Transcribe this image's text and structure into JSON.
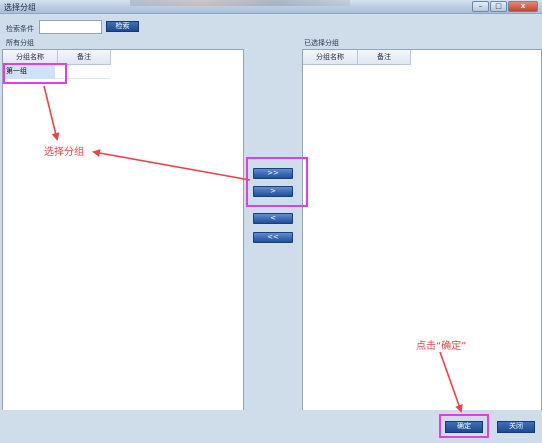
{
  "window": {
    "title": "选择分组",
    "minimize": "–",
    "maximize": "□",
    "close": "x"
  },
  "search": {
    "label": "检索条件",
    "value": "",
    "button": "检索"
  },
  "left_panel": {
    "label": "所有分组",
    "columns": [
      "分组名称",
      "备注"
    ],
    "rows": [
      {
        "name": "第一组",
        "note": ""
      }
    ]
  },
  "right_panel": {
    "label": "已选择分组",
    "columns": [
      "分组名称",
      "备注"
    ],
    "rows": []
  },
  "transfer": {
    "add_all": ">>",
    "add_one": ">",
    "remove_one": "<",
    "remove_all": "<<"
  },
  "footer": {
    "ok": "确定",
    "close": "关闭"
  },
  "annotations": {
    "select_group": "选择分组",
    "click_ok": "点击“确定”"
  },
  "colors": {
    "highlight": "#e040e0",
    "annotation": "#e8444a",
    "button": "#1d4a91"
  }
}
